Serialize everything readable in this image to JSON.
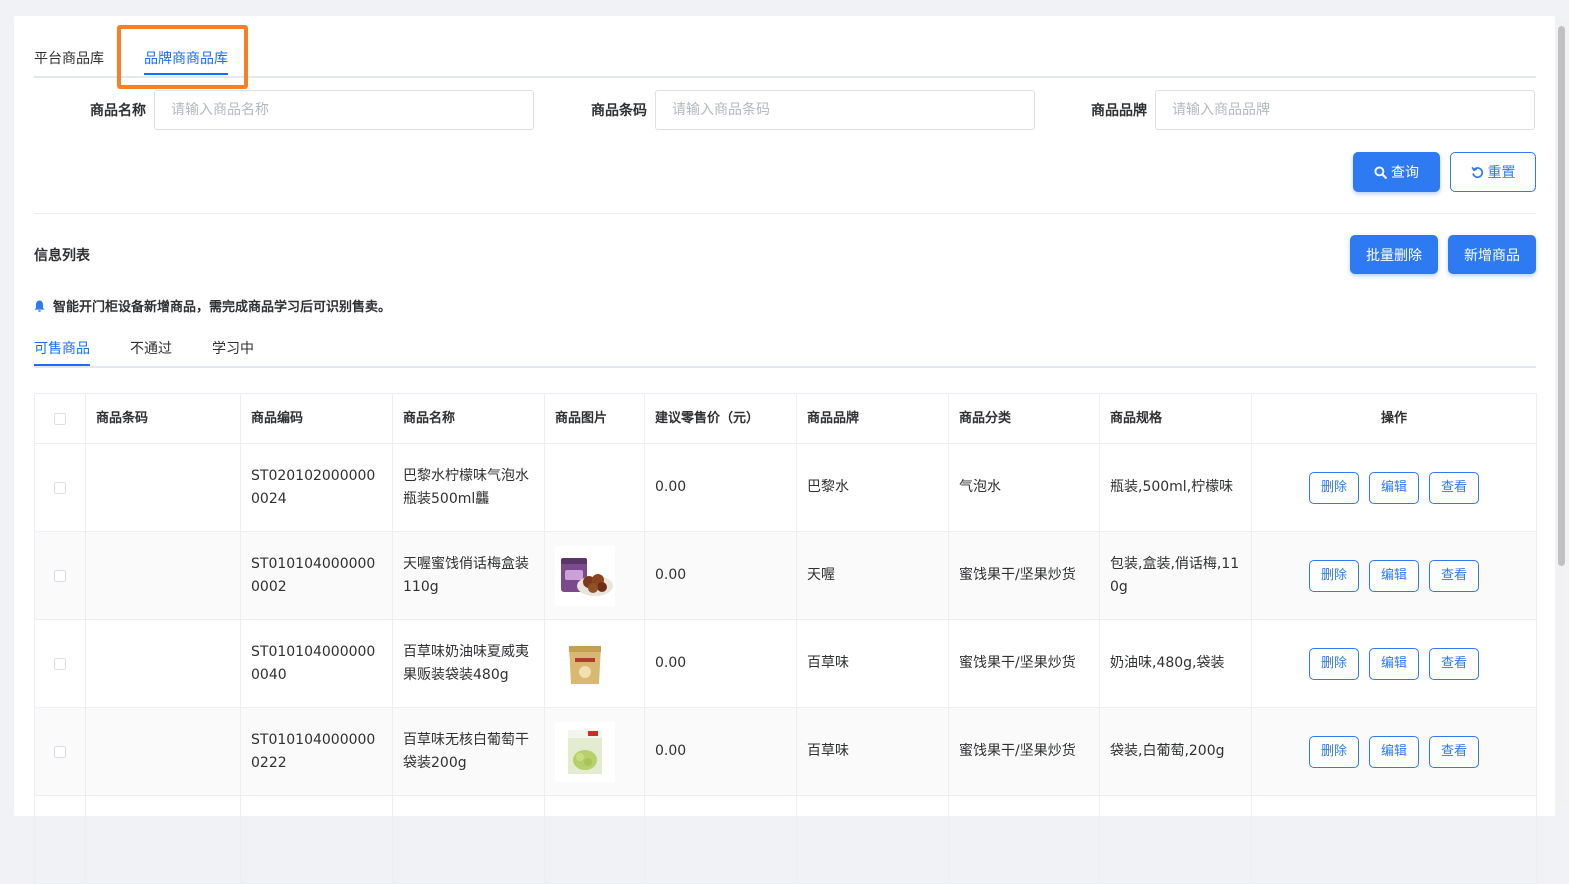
{
  "top_tabs": [
    "平台商品库",
    "品牌商商品库"
  ],
  "active_top_tab": 1,
  "filters": [
    {
      "label": "商品名称",
      "placeholder": "请输入商品名称",
      "value": ""
    },
    {
      "label": "商品条码",
      "placeholder": "请输入商品条码",
      "value": ""
    },
    {
      "label": "商品品牌",
      "placeholder": "请输入商品品牌",
      "value": ""
    }
  ],
  "buttons": {
    "query": "查询",
    "reset": "重置",
    "batch_delete": "批量删除",
    "add_product": "新增商品"
  },
  "section_title": "信息列表",
  "notice": "智能开门柜设备新增商品，需完成商品学习后可识别售卖。",
  "sub_tabs": [
    "可售商品",
    "不通过",
    "学习中"
  ],
  "active_sub_tab": 0,
  "table": {
    "headers": [
      "商品条码",
      "商品编码",
      "商品名称",
      "商品图片",
      "建议零售价（元）",
      "商品品牌",
      "商品分类",
      "商品规格",
      "操作"
    ],
    "row_actions": [
      "删除",
      "编辑",
      "查看"
    ],
    "rows": [
      {
        "barcode": "",
        "code": "ST0201020000000024",
        "name": "巴黎水柠檬味气泡水瓶装500ml龘",
        "image": "",
        "price": "0.00",
        "brand": "巴黎水",
        "category": "气泡水",
        "spec": "瓶装,500ml,柠檬味"
      },
      {
        "barcode": "",
        "code": "ST0101040000000002",
        "name": "天喔蜜饯俏话梅盒装110g",
        "image": "prune-jar",
        "price": "0.00",
        "brand": "天喔",
        "category": "蜜饯果干/坚果炒货",
        "spec": "包装,盒装,俏话梅,110g"
      },
      {
        "barcode": "",
        "code": "ST0101040000000040",
        "name": "百草味奶油味夏威夷果贩装袋装480g",
        "image": "nut-bag",
        "price": "0.00",
        "brand": "百草味",
        "category": "蜜饯果干/坚果炒货",
        "spec": "奶油味,480g,袋装"
      },
      {
        "barcode": "",
        "code": "ST0101040000000222",
        "name": "百草味无核白葡萄干袋装200g",
        "image": "raisin-bag",
        "price": "0.00",
        "brand": "百草味",
        "category": "蜜饯果干/坚果炒货",
        "spec": "袋装,白葡萄,200g"
      }
    ]
  },
  "colors": {
    "primary": "#2d7af2",
    "active_tab": "#1a6dff",
    "highlight": "#f58026"
  }
}
